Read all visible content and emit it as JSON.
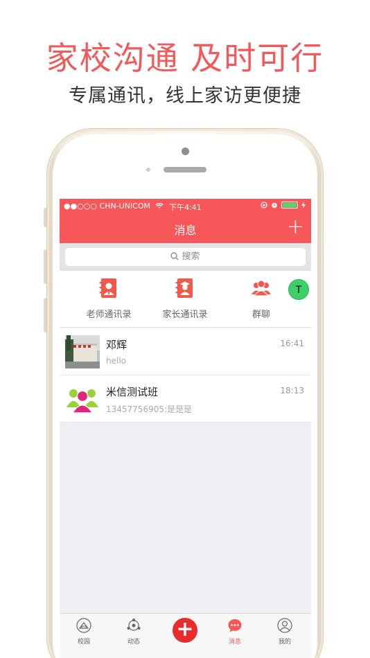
{
  "promo": {
    "title": "家校沟通 及时可行",
    "subtitle": "专属通讯，线上家访更便捷"
  },
  "status_bar": {
    "carrier": "●●○○○ CHN-UNICOM",
    "time": "下午4:41"
  },
  "navbar": {
    "title": "消息",
    "add": "+"
  },
  "search": {
    "placeholder": "搜索"
  },
  "quick_actions": [
    {
      "label": "老师通讯录",
      "icon": "teacher-contacts-icon"
    },
    {
      "label": "家长通讯录",
      "icon": "parent-contacts-icon"
    },
    {
      "label": "群聊",
      "icon": "group-chat-icon"
    }
  ],
  "floating_avatar": "T",
  "conversations": [
    {
      "name": "邓辉",
      "preview": "hello",
      "time": "16:41"
    },
    {
      "name": "米信测试班",
      "preview": "13457756905:是是是",
      "time": "18:13"
    }
  ],
  "tabbar": [
    {
      "label": "校园",
      "icon": "campus-icon"
    },
    {
      "label": "动态",
      "icon": "moments-icon"
    },
    {
      "label": "+",
      "icon": "plus-icon"
    },
    {
      "label": "消息",
      "icon": "message-icon",
      "active": true
    },
    {
      "label": "我的",
      "icon": "profile-icon"
    }
  ],
  "colors": {
    "brand": "#f8575a",
    "promo_title": "#f05a5a",
    "center_button": "#ea2b2b",
    "avatar_t": "#3ecf6b"
  }
}
